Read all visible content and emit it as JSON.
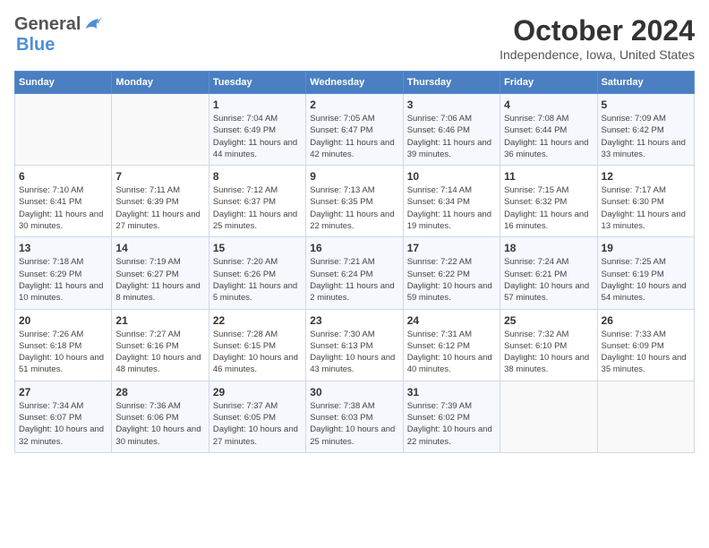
{
  "header": {
    "logo_general": "General",
    "logo_blue": "Blue",
    "title": "October 2024",
    "location": "Independence, Iowa, United States"
  },
  "weekdays": [
    "Sunday",
    "Monday",
    "Tuesday",
    "Wednesday",
    "Thursday",
    "Friday",
    "Saturday"
  ],
  "weeks": [
    [
      {
        "day": "",
        "info": ""
      },
      {
        "day": "",
        "info": ""
      },
      {
        "day": "1",
        "sunrise": "Sunrise: 7:04 AM",
        "sunset": "Sunset: 6:49 PM",
        "daylight": "Daylight: 11 hours and 44 minutes."
      },
      {
        "day": "2",
        "sunrise": "Sunrise: 7:05 AM",
        "sunset": "Sunset: 6:47 PM",
        "daylight": "Daylight: 11 hours and 42 minutes."
      },
      {
        "day": "3",
        "sunrise": "Sunrise: 7:06 AM",
        "sunset": "Sunset: 6:46 PM",
        "daylight": "Daylight: 11 hours and 39 minutes."
      },
      {
        "day": "4",
        "sunrise": "Sunrise: 7:08 AM",
        "sunset": "Sunset: 6:44 PM",
        "daylight": "Daylight: 11 hours and 36 minutes."
      },
      {
        "day": "5",
        "sunrise": "Sunrise: 7:09 AM",
        "sunset": "Sunset: 6:42 PM",
        "daylight": "Daylight: 11 hours and 33 minutes."
      }
    ],
    [
      {
        "day": "6",
        "sunrise": "Sunrise: 7:10 AM",
        "sunset": "Sunset: 6:41 PM",
        "daylight": "Daylight: 11 hours and 30 minutes."
      },
      {
        "day": "7",
        "sunrise": "Sunrise: 7:11 AM",
        "sunset": "Sunset: 6:39 PM",
        "daylight": "Daylight: 11 hours and 27 minutes."
      },
      {
        "day": "8",
        "sunrise": "Sunrise: 7:12 AM",
        "sunset": "Sunset: 6:37 PM",
        "daylight": "Daylight: 11 hours and 25 minutes."
      },
      {
        "day": "9",
        "sunrise": "Sunrise: 7:13 AM",
        "sunset": "Sunset: 6:35 PM",
        "daylight": "Daylight: 11 hours and 22 minutes."
      },
      {
        "day": "10",
        "sunrise": "Sunrise: 7:14 AM",
        "sunset": "Sunset: 6:34 PM",
        "daylight": "Daylight: 11 hours and 19 minutes."
      },
      {
        "day": "11",
        "sunrise": "Sunrise: 7:15 AM",
        "sunset": "Sunset: 6:32 PM",
        "daylight": "Daylight: 11 hours and 16 minutes."
      },
      {
        "day": "12",
        "sunrise": "Sunrise: 7:17 AM",
        "sunset": "Sunset: 6:30 PM",
        "daylight": "Daylight: 11 hours and 13 minutes."
      }
    ],
    [
      {
        "day": "13",
        "sunrise": "Sunrise: 7:18 AM",
        "sunset": "Sunset: 6:29 PM",
        "daylight": "Daylight: 11 hours and 10 minutes."
      },
      {
        "day": "14",
        "sunrise": "Sunrise: 7:19 AM",
        "sunset": "Sunset: 6:27 PM",
        "daylight": "Daylight: 11 hours and 8 minutes."
      },
      {
        "day": "15",
        "sunrise": "Sunrise: 7:20 AM",
        "sunset": "Sunset: 6:26 PM",
        "daylight": "Daylight: 11 hours and 5 minutes."
      },
      {
        "day": "16",
        "sunrise": "Sunrise: 7:21 AM",
        "sunset": "Sunset: 6:24 PM",
        "daylight": "Daylight: 11 hours and 2 minutes."
      },
      {
        "day": "17",
        "sunrise": "Sunrise: 7:22 AM",
        "sunset": "Sunset: 6:22 PM",
        "daylight": "Daylight: 10 hours and 59 minutes."
      },
      {
        "day": "18",
        "sunrise": "Sunrise: 7:24 AM",
        "sunset": "Sunset: 6:21 PM",
        "daylight": "Daylight: 10 hours and 57 minutes."
      },
      {
        "day": "19",
        "sunrise": "Sunrise: 7:25 AM",
        "sunset": "Sunset: 6:19 PM",
        "daylight": "Daylight: 10 hours and 54 minutes."
      }
    ],
    [
      {
        "day": "20",
        "sunrise": "Sunrise: 7:26 AM",
        "sunset": "Sunset: 6:18 PM",
        "daylight": "Daylight: 10 hours and 51 minutes."
      },
      {
        "day": "21",
        "sunrise": "Sunrise: 7:27 AM",
        "sunset": "Sunset: 6:16 PM",
        "daylight": "Daylight: 10 hours and 48 minutes."
      },
      {
        "day": "22",
        "sunrise": "Sunrise: 7:28 AM",
        "sunset": "Sunset: 6:15 PM",
        "daylight": "Daylight: 10 hours and 46 minutes."
      },
      {
        "day": "23",
        "sunrise": "Sunrise: 7:30 AM",
        "sunset": "Sunset: 6:13 PM",
        "daylight": "Daylight: 10 hours and 43 minutes."
      },
      {
        "day": "24",
        "sunrise": "Sunrise: 7:31 AM",
        "sunset": "Sunset: 6:12 PM",
        "daylight": "Daylight: 10 hours and 40 minutes."
      },
      {
        "day": "25",
        "sunrise": "Sunrise: 7:32 AM",
        "sunset": "Sunset: 6:10 PM",
        "daylight": "Daylight: 10 hours and 38 minutes."
      },
      {
        "day": "26",
        "sunrise": "Sunrise: 7:33 AM",
        "sunset": "Sunset: 6:09 PM",
        "daylight": "Daylight: 10 hours and 35 minutes."
      }
    ],
    [
      {
        "day": "27",
        "sunrise": "Sunrise: 7:34 AM",
        "sunset": "Sunset: 6:07 PM",
        "daylight": "Daylight: 10 hours and 32 minutes."
      },
      {
        "day": "28",
        "sunrise": "Sunrise: 7:36 AM",
        "sunset": "Sunset: 6:06 PM",
        "daylight": "Daylight: 10 hours and 30 minutes."
      },
      {
        "day": "29",
        "sunrise": "Sunrise: 7:37 AM",
        "sunset": "Sunset: 6:05 PM",
        "daylight": "Daylight: 10 hours and 27 minutes."
      },
      {
        "day": "30",
        "sunrise": "Sunrise: 7:38 AM",
        "sunset": "Sunset: 6:03 PM",
        "daylight": "Daylight: 10 hours and 25 minutes."
      },
      {
        "day": "31",
        "sunrise": "Sunrise: 7:39 AM",
        "sunset": "Sunset: 6:02 PM",
        "daylight": "Daylight: 10 hours and 22 minutes."
      },
      {
        "day": "",
        "info": ""
      },
      {
        "day": "",
        "info": ""
      }
    ]
  ]
}
